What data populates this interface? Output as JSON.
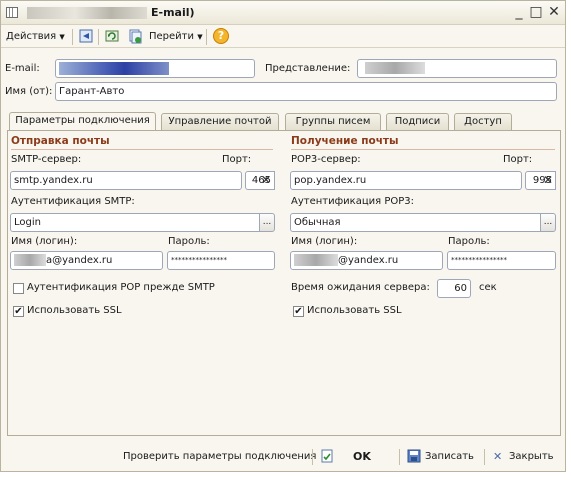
{
  "window": {
    "title_suffix": "E-mail)",
    "minimize": "_",
    "maximize": "□",
    "close": "✕"
  },
  "toolbar": {
    "actions": "Действия",
    "goto": "Перейти",
    "help_symbol": "?"
  },
  "header": {
    "email_label": "E-mail:",
    "presentation_label": "Представление:",
    "name_label": "Имя (от):",
    "name_value": "Гарант-Авто"
  },
  "tabs": [
    {
      "label": "Параметры подключения",
      "active": true
    },
    {
      "label": "Управление почтой",
      "active": false
    },
    {
      "label": "Группы писем",
      "active": false
    },
    {
      "label": "Подписи",
      "active": false
    },
    {
      "label": "Доступ",
      "active": false
    }
  ],
  "send": {
    "title": "Отправка почты",
    "server_label": "SMTP-сервер:",
    "server_value": "smtp.yandex.ru",
    "port_label": "Порт:",
    "port_value": "465",
    "auth_label": "Аутентификация SMTP:",
    "auth_value": "Login",
    "login_label": "Имя (логин):",
    "login_value": "a@yandex.ru",
    "password_label": "Пароль:",
    "password_value": "****************",
    "pop_before_smtp_label": "Аутентификация POP прежде SMTP",
    "pop_before_smtp_checked": false,
    "ssl_label": "Использовать SSL",
    "ssl_checked": true
  },
  "receive": {
    "title": "Получение почты",
    "server_label": "POP3-сервер:",
    "server_value": "pop.yandex.ru",
    "port_label": "Порт:",
    "port_value": "995",
    "auth_label": "Аутентификация POP3:",
    "auth_value": "Обычная",
    "login_label": "Имя (логин):",
    "login_value": "@yandex.ru",
    "password_label": "Пароль:",
    "password_value": "****************",
    "timeout_label": "Время ожидания сервера:",
    "timeout_value": "60",
    "timeout_unit": "сек",
    "ssl_label": "Использовать SSL",
    "ssl_checked": true
  },
  "footer": {
    "check": "Проверить параметры подключения",
    "ok": "OK",
    "save": "Записать",
    "close": "Закрыть"
  }
}
